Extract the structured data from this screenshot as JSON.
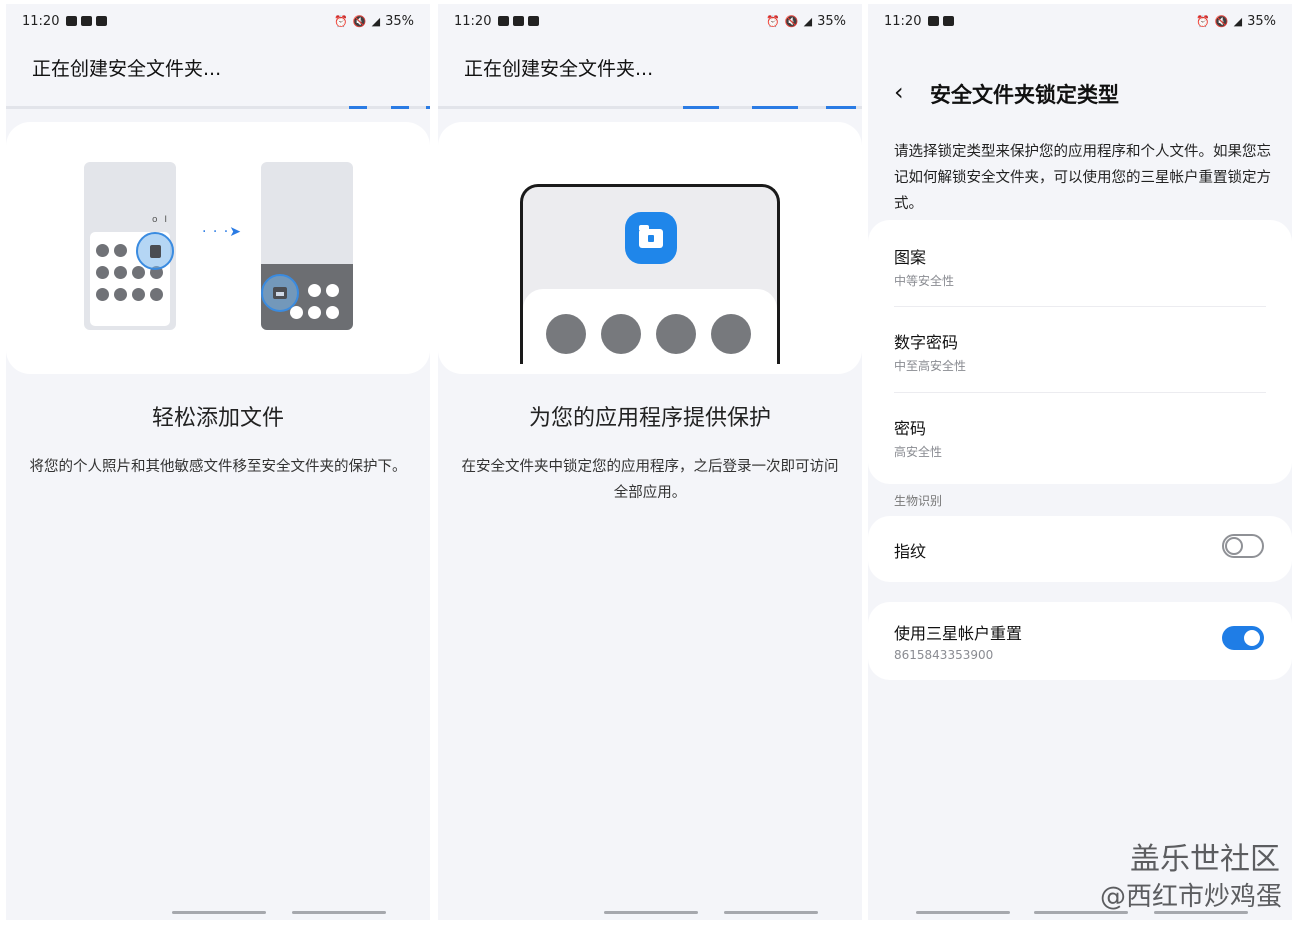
{
  "status": {
    "time": "11:20",
    "battery": "35%"
  },
  "screen1": {
    "header_title": "正在创建安全文件夹...",
    "heading": "轻松添加文件",
    "description": "将您的个人照片和其他敏感文件移至安全文件夹的保护下。",
    "illustration_label": "o I"
  },
  "screen2": {
    "header_title": "正在创建安全文件夹...",
    "heading": "为您的应用程序提供保护",
    "description": "在安全文件夹中锁定您的应用程序，之后登录一次即可访问全部应用。"
  },
  "screen3": {
    "title": "安全文件夹锁定类型",
    "description": "请选择锁定类型来保护您的应用程序和个人文件。如果您忘记如何解锁安全文件夹，可以使用您的三星帐户重置锁定方式。",
    "options": [
      {
        "label": "图案",
        "sub": "中等安全性"
      },
      {
        "label": "数字密码",
        "sub": "中至高安全性"
      },
      {
        "label": "密码",
        "sub": "高安全性"
      }
    ],
    "biometrics_section": "生物识别",
    "fingerprint": {
      "label": "指纹",
      "enabled": false
    },
    "samsung_reset": {
      "label": "使用三星帐户重置",
      "sub": "8615843353900",
      "enabled": true
    }
  },
  "watermark": {
    "line1": "盖乐世社区",
    "line2": "@西红市炒鸡蛋"
  },
  "colors": {
    "accent": "#1f7de6",
    "background": "#f4f5f9",
    "card": "#ffffff"
  }
}
